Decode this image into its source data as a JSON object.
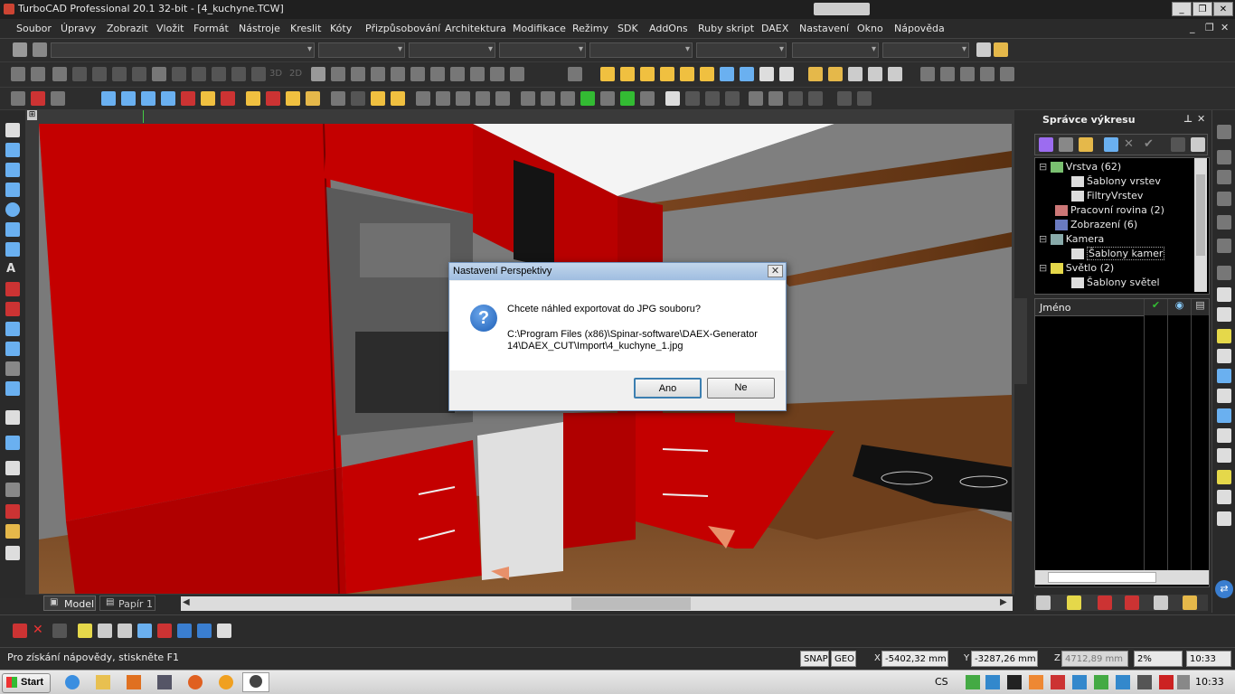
{
  "window": {
    "title": "TurboCAD Professional 20.1 32-bit - [4_kuchyne.TCW]",
    "minimize": "_",
    "restore": "❐",
    "close": "✕"
  },
  "menu": [
    "Soubor",
    "Úpravy",
    "Zobrazit",
    "Vložit",
    "Formát",
    "Nástroje",
    "Kreslit",
    "Kóty",
    "Přizpůsobování",
    "Architektura",
    "Modifikace",
    "Režimy",
    "SDK",
    "AddOns",
    "Ruby skript",
    "DAEX",
    "Nastavení",
    "Okno",
    "Nápověda"
  ],
  "toolbar3": {
    "view_3d": "3D",
    "view_2d": "2D"
  },
  "dialog": {
    "title": "Nastavení Perspektivy",
    "close": "✕",
    "question_icon": "?",
    "message": "Chcete náhled exportovat do JPG souboru?",
    "path_line1": "C:\\Program Files (x86)\\Spinar-software\\DAEX-Generator",
    "path_line2": "14\\DAEX_CUT\\Import\\4_kuchyne_1.jpg",
    "yes_label": "Ano",
    "no_label": "Ne"
  },
  "drawing_manager": {
    "title": "Správce výkresu",
    "pin": "⊥",
    "close": "✕",
    "tree": [
      {
        "label": "Vrstva (62)",
        "level": 0,
        "expanded": true,
        "icon": "layers-icon"
      },
      {
        "label": "Šablony vrstev",
        "level": 1,
        "icon": "template-icon"
      },
      {
        "label": "FiltryVrstev",
        "level": 1,
        "icon": "filter-icon"
      },
      {
        "label": "Pracovní rovina (2)",
        "level": 0,
        "icon": "workplane-icon"
      },
      {
        "label": "Zobrazení (6)",
        "level": 0,
        "icon": "view-icon"
      },
      {
        "label": "Kamera",
        "level": 0,
        "expanded": true,
        "icon": "camera-icon"
      },
      {
        "label": "Šablony kamer",
        "level": 1,
        "icon": "template-icon",
        "selected": true
      },
      {
        "label": "Světlo (2)",
        "level": 0,
        "expanded": true,
        "icon": "light-icon"
      },
      {
        "label": "Šablony světel",
        "level": 1,
        "icon": "template-icon"
      }
    ],
    "table_header": "Jméno"
  },
  "tabs": {
    "model": "Model",
    "paper": "Papír 1"
  },
  "status": {
    "help": "Pro získání nápovědy, stiskněte F1",
    "snap": "SNAP",
    "geo": "GEO",
    "x_label": "X",
    "x": "-5402,32 mm",
    "y_label": "Y",
    "y": "-3287,26 mm",
    "z_label": "Z",
    "z": "4712,89 mm",
    "zoom": "2%",
    "time": "10:33"
  },
  "taskbar": {
    "start": "Start",
    "lang": "CS",
    "clock": "10:33"
  },
  "colors": {
    "cabinet_red": "#c40000",
    "wall_gray": "#7a7a7a",
    "floor_wood": "#7a4a26"
  }
}
